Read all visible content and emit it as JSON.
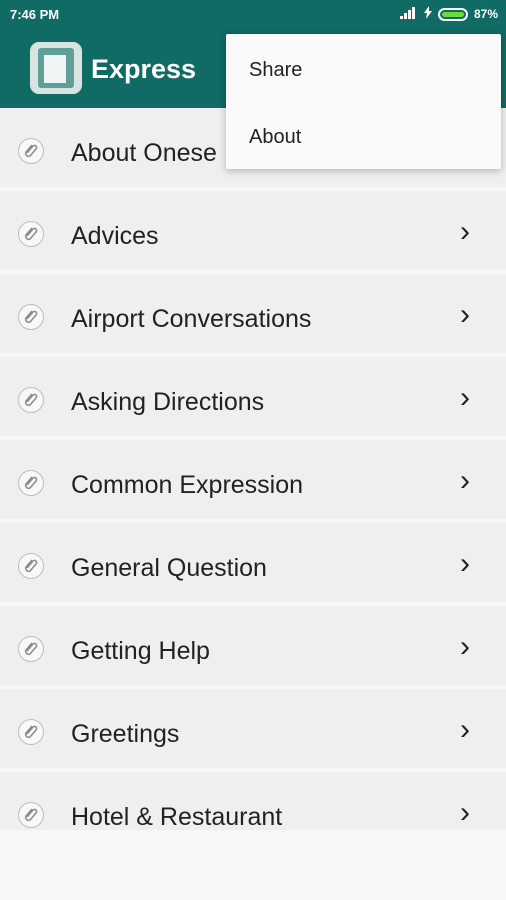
{
  "status": {
    "time": "7:46 PM",
    "battery": "87%",
    "battery_level": 0.87
  },
  "app": {
    "title": "Express"
  },
  "list": {
    "items": [
      {
        "label": "About Onese"
      },
      {
        "label": "Advices"
      },
      {
        "label": "Airport Conversations"
      },
      {
        "label": "Asking Directions"
      },
      {
        "label": "Common Expression"
      },
      {
        "label": "General Question"
      },
      {
        "label": "Getting Help"
      },
      {
        "label": "Greetings"
      },
      {
        "label": "Hotel & Restaurant"
      }
    ],
    "chevron": "›"
  },
  "menu": {
    "share": "Share",
    "about": "About"
  },
  "colors": {
    "primary": "#0f6b63",
    "list_bg": "#efefef",
    "battery": "#6ddc3a"
  },
  "icons": {
    "list_item": "paperclip-icon",
    "logo": "book-icon",
    "chevron": "chevron-right-icon"
  }
}
